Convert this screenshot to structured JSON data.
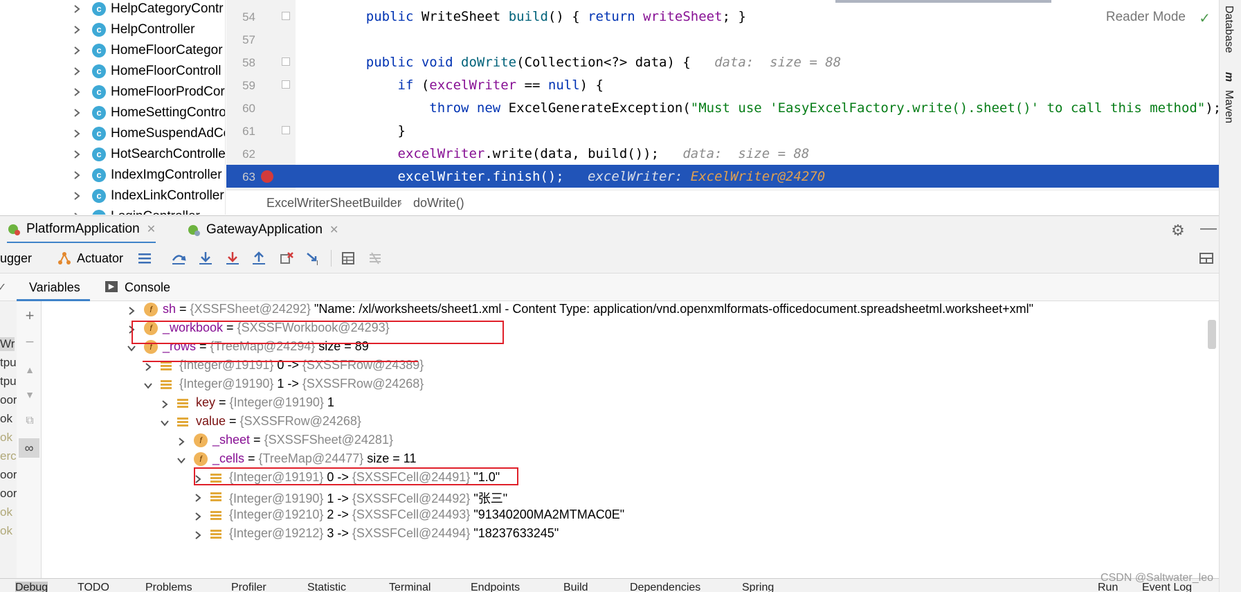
{
  "project_tree": {
    "items": [
      {
        "label": "HelpCategoryContr"
      },
      {
        "label": "HelpController"
      },
      {
        "label": "HomeFloorCategor"
      },
      {
        "label": "HomeFloorControll"
      },
      {
        "label": "HomeFloorProdCor"
      },
      {
        "label": "HomeSettingContro"
      },
      {
        "label": "HomeSuspendAdCo"
      },
      {
        "label": "HotSearchControlle"
      },
      {
        "label": "IndexImgController"
      },
      {
        "label": "IndexLinkController"
      },
      {
        "label": "LoginController"
      }
    ]
  },
  "editor": {
    "lines": [
      {
        "num": "54",
        "parts": [
          [
            "    ",
            ""
          ],
          [
            "public ",
            "kw"
          ],
          [
            "WriteSheet ",
            ""
          ],
          [
            "build",
            "fn"
          ],
          [
            "() { ",
            ""
          ],
          [
            "return ",
            "kw"
          ],
          [
            "writeSheet",
            "fld"
          ],
          [
            "; }",
            ""
          ]
        ]
      },
      {
        "num": "57",
        "parts": []
      },
      {
        "num": "58",
        "parts": [
          [
            "    ",
            ""
          ],
          [
            "public void ",
            "kw"
          ],
          [
            "doWrite",
            "fn"
          ],
          [
            "(Collection<?> data) {",
            ""
          ],
          [
            "   data:  size = 88",
            "hint"
          ]
        ]
      },
      {
        "num": "59",
        "parts": [
          [
            "        ",
            ""
          ],
          [
            "if ",
            "kw"
          ],
          [
            "(",
            ""
          ],
          [
            "excelWriter",
            "fld"
          ],
          [
            " == ",
            ""
          ],
          [
            "null",
            "kw"
          ],
          [
            ") {",
            ""
          ]
        ]
      },
      {
        "num": "60",
        "parts": [
          [
            "            ",
            ""
          ],
          [
            "throw new ",
            "kw"
          ],
          [
            "ExcelGenerateException(",
            ""
          ],
          [
            "\"Must use 'EasyExcelFactory.write().sheet()' to call this method\"",
            "str"
          ],
          [
            ");",
            ""
          ]
        ]
      },
      {
        "num": "61",
        "parts": [
          [
            "        }",
            ""
          ]
        ]
      },
      {
        "num": "62",
        "parts": [
          [
            "        ",
            ""
          ],
          [
            "excelWriter",
            "fld"
          ],
          [
            ".write(data, build());",
            ""
          ],
          [
            "   data:  size = 88",
            "hint"
          ]
        ]
      },
      {
        "num": "63",
        "parts": [
          [
            "        excelWriter.finish();",
            ""
          ],
          [
            "   excelWriter: ",
            "hint"
          ],
          [
            "ExcelWriter@24270",
            "hint2"
          ]
        ]
      }
    ],
    "reader_mode": "Reader Mode",
    "breadcrumb": {
      "cls": "ExcelWriterSheetBuilder",
      "sep": "›",
      "method": "doWrite()"
    }
  },
  "right_strip": {
    "database": "Database",
    "maven": "Maven"
  },
  "run_tabs": {
    "tab1": "PlatformApplication",
    "tab2": "GatewayApplication"
  },
  "toolbar": {
    "debugger": "ugger",
    "actuator": "Actuator"
  },
  "subtabs": {
    "variables": "Variables",
    "console": "Console"
  },
  "left_col": [
    "Wr",
    "tpu",
    "tpu",
    "oor",
    "ok",
    "ok",
    "erc",
    "oor",
    "oor",
    "ok",
    "ok"
  ],
  "variables": [
    {
      "ind": 183,
      "exp": "right",
      "icon": "f",
      "name": "sh",
      "ref": "{XSSFSheet@24292}",
      "val": " \"Name: /xl/worksheets/sheet1.xml - Content Type: application/vnd.openxmlformats-officedocument.spreadsheetml.worksheet+xml\""
    },
    {
      "ind": 183,
      "exp": "right",
      "icon": "f",
      "name": "_workbook",
      "ref": "{SXSSFWorkbook@24293}",
      "val": ""
    },
    {
      "ind": 183,
      "exp": "down",
      "icon": "f",
      "name": "_rows",
      "ref": "{TreeMap@24294}",
      "val": "  size = 89"
    },
    {
      "ind": 207,
      "exp": "right",
      "icon": "l",
      "name": "",
      "ref": "{Integer@19191}",
      "val": " 0 -> ",
      "ref2": "{SXSSFRow@24389}"
    },
    {
      "ind": 207,
      "exp": "down",
      "icon": "l",
      "name": "",
      "ref": "{Integer@19190}",
      "val": " 1 -> ",
      "ref2": "{SXSSFRow@24268}"
    },
    {
      "ind": 231,
      "exp": "right",
      "icon": "l",
      "name": "key",
      "ref": "{Integer@19190}",
      "val": " 1"
    },
    {
      "ind": 231,
      "exp": "down",
      "icon": "l",
      "name": "value",
      "ref": "{SXSSFRow@24268}",
      "val": ""
    },
    {
      "ind": 255,
      "exp": "right",
      "icon": "f",
      "name": "_sheet",
      "ref": "{SXSSFSheet@24281}",
      "val": ""
    },
    {
      "ind": 255,
      "exp": "down",
      "icon": "f",
      "name": "_cells",
      "ref": "{TreeMap@24477}",
      "val": "  size = 11"
    },
    {
      "ind": 279,
      "exp": "right",
      "icon": "l",
      "name": "",
      "ref": "{Integer@19191}",
      "val": " 0 -> ",
      "ref2": "{SXSSFCell@24491}",
      "val2": " \"1.0\""
    },
    {
      "ind": 279,
      "exp": "right",
      "icon": "l",
      "name": "",
      "ref": "{Integer@19190}",
      "val": " 1 -> ",
      "ref2": "{SXSSFCell@24492}",
      "val2": " \"张三\""
    },
    {
      "ind": 279,
      "exp": "right",
      "icon": "l",
      "name": "",
      "ref": "{Integer@19210}",
      "val": " 2 -> ",
      "ref2": "{SXSSFCell@24493}",
      "val2": " \"91340200MA2MTMAC0E\""
    },
    {
      "ind": 279,
      "exp": "right",
      "icon": "l",
      "name": "",
      "ref": "{Integer@19212}",
      "val": " 3 -> ",
      "ref2": "{SXSSFCell@24494}",
      "val2": " \"18237633245\""
    }
  ],
  "bottom_bar": [
    "Debug",
    "TODO",
    "Problems",
    "Profiler",
    "Statistic",
    "Terminal",
    "Endpoints",
    "Build",
    "Dependencies",
    "Spring",
    "Run",
    "Event Log"
  ],
  "watermark": "CSDN @Saltwater_leo"
}
